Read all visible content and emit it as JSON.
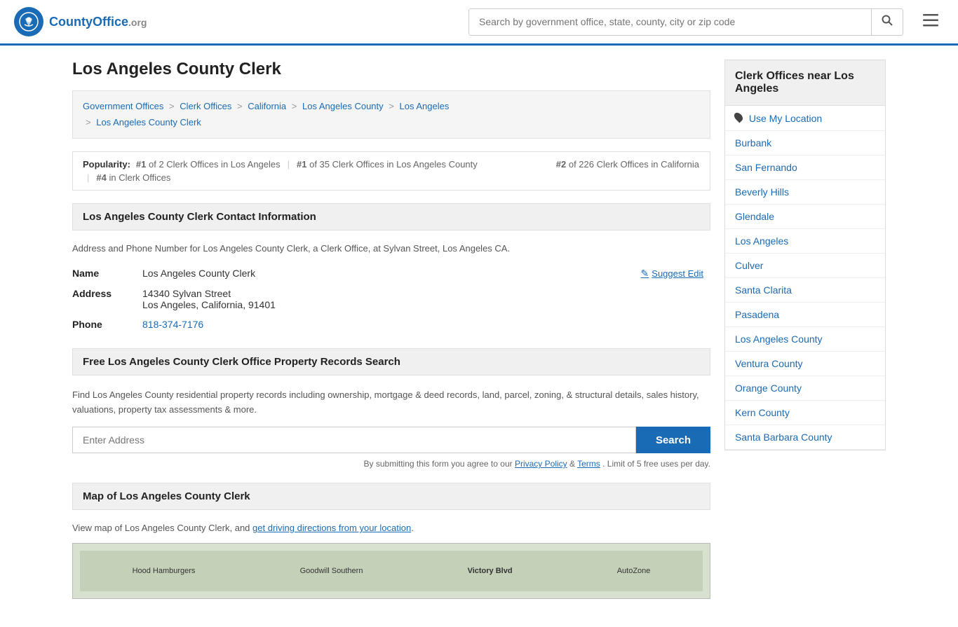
{
  "header": {
    "logo_text": "CountyOffice",
    "logo_org": ".org",
    "search_placeholder": "Search by government office, state, county, city or zip code",
    "search_btn_icon": "🔍"
  },
  "page": {
    "title": "Los Angeles County Clerk"
  },
  "breadcrumb": {
    "items": [
      {
        "label": "Government Offices",
        "url": "#"
      },
      {
        "label": "Clerk Offices",
        "url": "#"
      },
      {
        "label": "California",
        "url": "#"
      },
      {
        "label": "Los Angeles County",
        "url": "#"
      },
      {
        "label": "Los Angeles",
        "url": "#"
      },
      {
        "label": "Los Angeles County Clerk",
        "url": "#"
      }
    ]
  },
  "popularity": {
    "label": "Popularity:",
    "rank1": "#1 of 2 Clerk Offices in Los Angeles",
    "rank2": "#1 of 35 Clerk Offices in Los Angeles County",
    "rank3": "#2 of 226 Clerk Offices in California",
    "rank4": "#4 in Clerk Offices"
  },
  "contact_section": {
    "header": "Los Angeles County Clerk Contact Information",
    "desc": "Address and Phone Number for Los Angeles County Clerk, a Clerk Office, at Sylvan Street, Los Angeles CA.",
    "name_label": "Name",
    "name_value": "Los Angeles County Clerk",
    "address_label": "Address",
    "address_line1": "14340 Sylvan Street",
    "address_line2": "Los Angeles, California, 91401",
    "phone_label": "Phone",
    "phone_value": "818-374-7176",
    "suggest_edit_label": "Suggest Edit"
  },
  "property_section": {
    "header": "Free Los Angeles County Clerk Office Property Records Search",
    "desc": "Find Los Angeles County residential property records including ownership, mortgage & deed records, land, parcel, zoning, & structural details, sales history, valuations, property tax assessments & more.",
    "address_placeholder": "Enter Address",
    "search_btn_label": "Search",
    "disclaimer": "By submitting this form you agree to our",
    "privacy_label": "Privacy Policy",
    "and_text": "&",
    "terms_label": "Terms",
    "limit_text": ". Limit of 5 free uses per day."
  },
  "map_section": {
    "header": "Map of Los Angeles County Clerk",
    "desc": "View map of Los Angeles County Clerk, and",
    "directions_link": "get driving directions from your location",
    "map_labels": [
      "Hood Hamburgers",
      "Goodwill Southern",
      "Victory Blvd",
      "AutoZone"
    ]
  },
  "sidebar": {
    "header": "Clerk Offices near Los Angeles",
    "use_location_label": "Use My Location",
    "items": [
      {
        "label": "Burbank",
        "url": "#"
      },
      {
        "label": "San Fernando",
        "url": "#"
      },
      {
        "label": "Beverly Hills",
        "url": "#"
      },
      {
        "label": "Glendale",
        "url": "#"
      },
      {
        "label": "Los Angeles",
        "url": "#"
      },
      {
        "label": "Culver",
        "url": "#"
      },
      {
        "label": "Santa Clarita",
        "url": "#"
      },
      {
        "label": "Pasadena",
        "url": "#"
      },
      {
        "label": "Los Angeles County",
        "url": "#"
      },
      {
        "label": "Ventura County",
        "url": "#"
      },
      {
        "label": "Orange County",
        "url": "#"
      },
      {
        "label": "Kern County",
        "url": "#"
      },
      {
        "label": "Santa Barbara County",
        "url": "#"
      }
    ]
  }
}
